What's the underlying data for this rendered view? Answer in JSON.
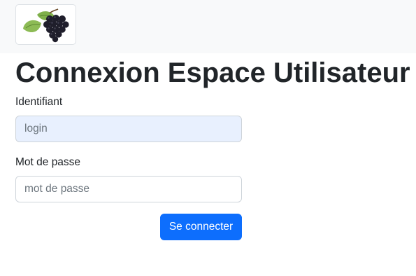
{
  "navbar": {
    "logo": {
      "icon": "grape-logo-icon",
      "colors": {
        "grape": "#1e1e2a",
        "leaf": "#7fb04a",
        "border": "#dee2e6"
      }
    }
  },
  "main": {
    "title": "Connexion Espace Utilisateur",
    "form": {
      "login_label": "Identifiant",
      "login_placeholder": "login",
      "login_value": "",
      "password_label": "Mot de passe",
      "password_placeholder": "mot de passe",
      "password_value": "",
      "submit_label": "Se connecter"
    }
  },
  "colors": {
    "primary": "#0d6efd",
    "navbar_bg": "#f8f9fa",
    "autofill_bg": "#e8f0fe",
    "text": "#212529"
  }
}
